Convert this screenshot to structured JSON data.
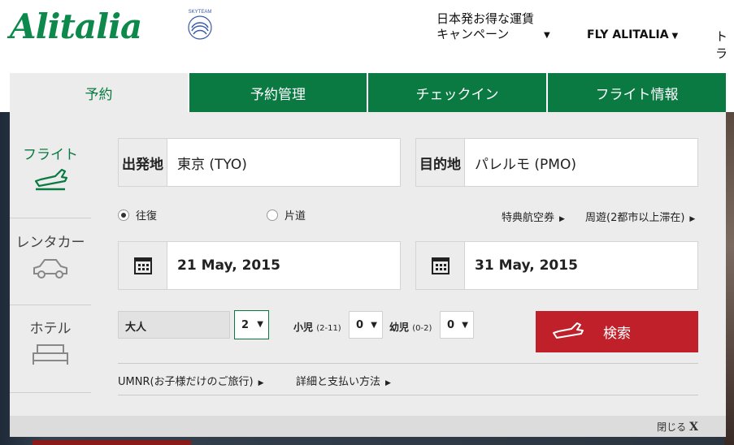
{
  "header": {
    "brand": "Alitalia",
    "skyteam_text": "SKYTEAM",
    "nav": {
      "campaign_line1": "日本発お得な運賃",
      "campaign_line2": "キャンペーン",
      "fly_alitalia": "FLY ALITALIA",
      "cut_item": "トラ"
    }
  },
  "tabs": [
    {
      "label": "予約",
      "active": true
    },
    {
      "label": "予約管理",
      "active": false
    },
    {
      "label": "チェックイン",
      "active": false
    },
    {
      "label": "フライト情報",
      "active": false
    }
  ],
  "side": {
    "flight": "フライト",
    "rentacar": "レンタカー",
    "hotel": "ホテル"
  },
  "form": {
    "origin_prefix": "出発地",
    "origin_value": "東京 (TYO)",
    "dest_prefix": "目的地",
    "dest_value": "パレルモ (PMO)",
    "trip_roundtrip": "往復",
    "trip_oneway": "片道",
    "selected_trip": "往復",
    "award_ticket": "特典航空券",
    "multi_city": "周遊(2都市以上滞在)",
    "depart_date": "21 May, 2015",
    "return_date": "31 May, 2015",
    "adults_label": "大人",
    "adults_value": "2",
    "children_label": "小児",
    "children_age": "(2-11)",
    "children_value": "0",
    "infants_label": "幼児",
    "infants_age": "(0-2)",
    "infants_value": "0",
    "search_label": "検索",
    "umnr_link": "UMNR(お子様だけのご旅行)",
    "payment_link": "詳細と支払い方法",
    "close_label": "閉じる",
    "close_x": "X"
  },
  "colors": {
    "brand_green": "#0a7a42",
    "search_red": "#c0202a"
  }
}
